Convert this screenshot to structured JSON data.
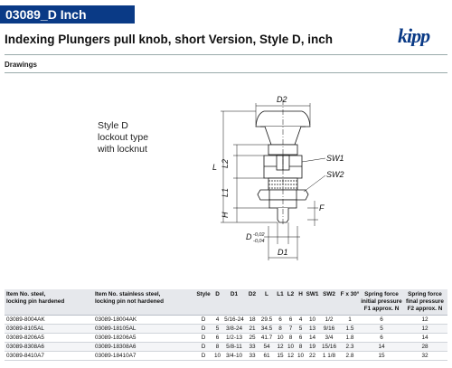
{
  "header": {
    "code": "03089_D Inch",
    "subtitle": "Indexing Plungers pull knob, short Version, Style D, inch",
    "section": "Drawings",
    "logo_text": "kipp"
  },
  "drawing": {
    "style_lines": [
      "Style D",
      "lockout type",
      "with locknut"
    ],
    "labels": {
      "D2": "D2",
      "L": "L",
      "L2": "L2",
      "L1": "L1",
      "H": "H",
      "SW1": "SW1",
      "SW2": "SW2",
      "F": "F",
      "D1": "D1",
      "D": "D",
      "tol_upper": "-0,02",
      "tol_lower": "-0,04"
    }
  },
  "table": {
    "headers": [
      "Item No. steel,\nlocking pin hardened",
      "Item No. stainless steel,\nlocking pin not hardened",
      "Style",
      "D",
      "D1",
      "D2",
      "L",
      "L1",
      "L2",
      "H",
      "SW1",
      "SW2",
      "F x 30°",
      "Spring force\ninitial pressure\nF1 approx. N",
      "Spring force\nfinal pressure\nF2 approx. N"
    ],
    "rows": [
      [
        "03089-8004AK",
        "03089-18004AK",
        "D",
        "4",
        "5/16-24",
        "18",
        "29.5",
        "6",
        "6",
        "4",
        "10",
        "1/2",
        "1",
        "6",
        "12"
      ],
      [
        "03089-8105AL",
        "03089-18105AL",
        "D",
        "5",
        "3/8-24",
        "21",
        "34.5",
        "8",
        "7",
        "5",
        "13",
        "9/16",
        "1.5",
        "5",
        "12"
      ],
      [
        "03089-8206A5",
        "03089-18206A5",
        "D",
        "6",
        "1/2-13",
        "25",
        "41.7",
        "10",
        "8",
        "6",
        "14",
        "3/4",
        "1.8",
        "6",
        "14"
      ],
      [
        "03089-8308A6",
        "03089-18308A6",
        "D",
        "8",
        "5/8-11",
        "33",
        "54",
        "12",
        "10",
        "8",
        "19",
        "15/16",
        "2.3",
        "14",
        "28"
      ],
      [
        "03089-8410A7",
        "03089-18410A7",
        "D",
        "10",
        "3/4-10",
        "33",
        "61",
        "15",
        "12",
        "10",
        "22",
        "1 1/8",
        "2.8",
        "15",
        "32"
      ]
    ]
  },
  "colors": {
    "brand_blue": "#0a3a86",
    "header_gray": "#e6e8ec"
  }
}
